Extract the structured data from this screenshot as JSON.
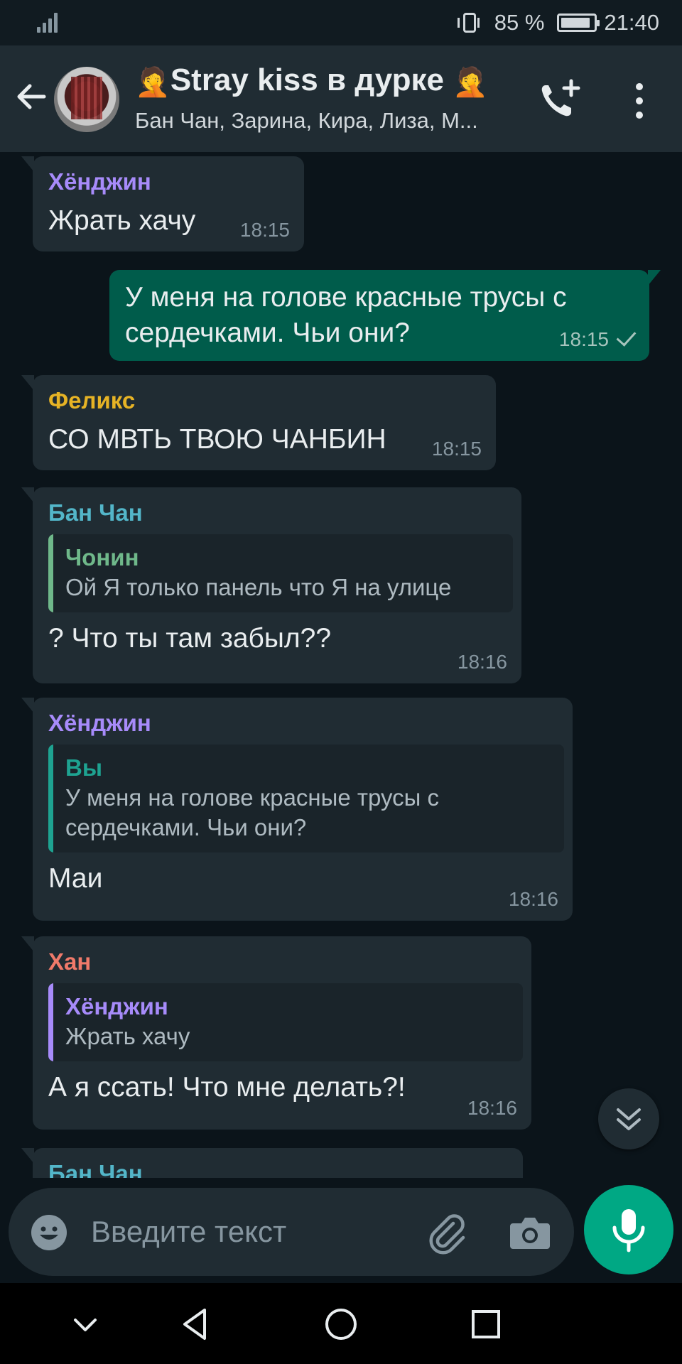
{
  "status_bar": {
    "battery": "85 %",
    "time": "21:40"
  },
  "header": {
    "title": "Stray kiss в дурке",
    "subtitle": "Бан Чан, Зарина, Кира, Лиза, М...",
    "emoji_left": "🤦",
    "emoji_right": "🤦"
  },
  "messages": [
    {
      "sender": "Хёнджин",
      "text": "Жрать хачу",
      "time": "18:15"
    },
    {
      "text": "У меня на голове красные трусы с сердечками. Чьи они?",
      "time": "18:15"
    },
    {
      "sender": "Феликс",
      "text": "СО МВТЬ ТВОЮ ЧАНБИН",
      "time": "18:15"
    },
    {
      "sender": "Бан Чан",
      "quote_author": "Чонин",
      "quote_text": "Ой Я только панель что Я на  улице",
      "text": "? Что ты там забыл??",
      "time": "18:16"
    },
    {
      "sender": "Хёнджин",
      "quote_author": "Вы",
      "quote_text": "У меня на голове красные трусы с сердечками. Чьи они?",
      "text": "Маи",
      "time": "18:16"
    },
    {
      "sender": "Хан",
      "quote_author": "Хёнджин",
      "quote_text": "Жрать хачу",
      "text": "А я ссать! Что мне делать?!",
      "time": "18:16"
    },
    {
      "sender": "Бан Чан"
    }
  ],
  "input": {
    "placeholder": "Введите текст"
  },
  "colors": {
    "hyunjin": "#a78bfa",
    "felix": "#e6b325",
    "bangchan": "#53b6c9",
    "jeongin": "#6fb88a",
    "you": "#1ea391",
    "han": "#f07a6a",
    "outgoing_bubble": "#005c4b",
    "incoming_bubble": "#202c33",
    "accent": "#00a884"
  }
}
